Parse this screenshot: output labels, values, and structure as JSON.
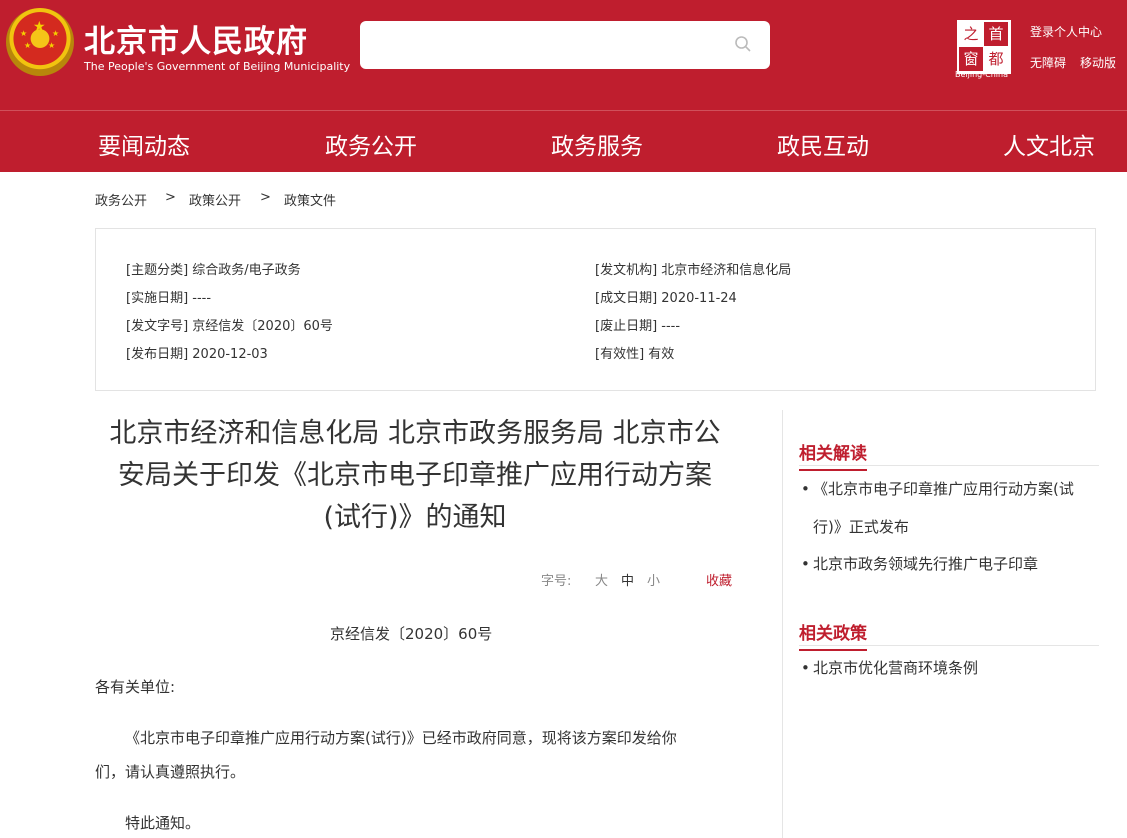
{
  "header": {
    "title": "北京市人民政府",
    "subtitle": "The People's Government of Beijing Municipality",
    "search": {
      "value": "",
      "placeholder": ""
    },
    "capital_logo": {
      "chars": [
        "之",
        "首",
        "窗",
        "都"
      ],
      "caption": "Beijing-China"
    },
    "links": {
      "login": "登录个人中心",
      "accessible": "无障碍",
      "mobile": "移动版"
    }
  },
  "nav": {
    "items": [
      "要闻动态",
      "政务公开",
      "政务服务",
      "政民互动",
      "人文北京"
    ]
  },
  "breadcrumb": {
    "items": [
      "政务公开",
      "政策公开",
      "政策文件"
    ],
    "separator": ">"
  },
  "info": {
    "topic": "[主题分类] 综合政务/电子政务",
    "issuer": "[发文机构] 北京市经济和信息化局",
    "effective": "[实施日期] ----",
    "written": "[成文日期] 2020-11-24",
    "doc_no": "[发文字号] 京经信发〔2020〕60号",
    "expire": "[废止日期] ----",
    "published": "[发布日期] 2020-12-03",
    "validity": "[有效性] 有效"
  },
  "article": {
    "title_lines": [
      "北京市经济和信息化局 北京市政务服务局 北京市公",
      "安局关于印发《北京市电子印章推广应用行动方案",
      "(试行)》的通知"
    ],
    "font_label": "字号:",
    "font_large": "大",
    "font_medium": "中",
    "font_small": "小",
    "favorite": "收藏",
    "doc_number": "京经信发〔2020〕60号",
    "greeting": "各有关单位:",
    "para1_line1": "《北京市电子印章推广应用行动方案(试行)》已经市政府同意，现将该方案印发给你",
    "para1_line2": "们，请认真遵照执行。",
    "closing": "特此通知。"
  },
  "sidebar": {
    "related_reading": {
      "title": "相关解读",
      "items": [
        {
          "line1": "《北京市电子印章推广应用行动方案(试",
          "line2": "行)》正式发布"
        },
        {
          "line1": "北京市政务领域先行推广电子印章"
        }
      ]
    },
    "related_policy": {
      "title": "相关政策",
      "items": [
        {
          "line1": "北京市优化营商环境条例"
        }
      ]
    },
    "bullet": "•"
  },
  "colors": {
    "brand_red": "#bf1e2e",
    "text": "#333333",
    "muted": "#888888"
  }
}
